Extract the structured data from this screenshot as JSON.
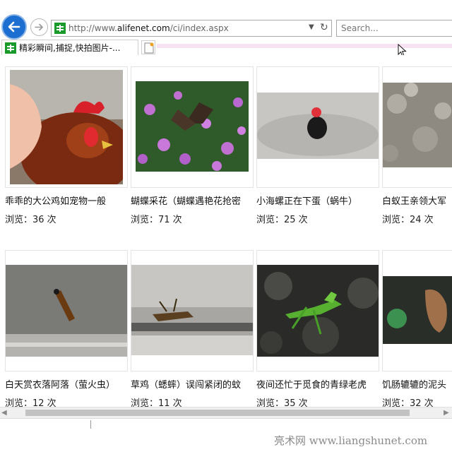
{
  "browser": {
    "address": {
      "url_prefix": "http://www.",
      "url_domain": "alifenet.com",
      "url_path": "/ci/index.aspx"
    },
    "search": {
      "placeholder": "Search..."
    },
    "tab": {
      "title": "精彩瞬间,捕捉,快拍图片-..."
    }
  },
  "gallery": {
    "items": [
      {
        "caption": "乖乖的大公鸡如宠物一般",
        "views": "浏览：36 次"
      },
      {
        "caption": "蝴蝶采花（蝴蝶遇艳花抢密",
        "views": "浏览：71 次"
      },
      {
        "caption": "小海螺正在下蛋（蜗牛）",
        "views": "浏览：25 次"
      },
      {
        "caption": "白蚁王亲领大军",
        "views": "浏览：24 次"
      },
      {
        "caption": "白天赏衣落阿落（萤火虫）",
        "views": "浏览：12 次"
      },
      {
        "caption": "草鸡（蟋蟀）误闯紧闭的蚊",
        "views": "浏览：11 次"
      },
      {
        "caption": "夜间还忙于觅食的青绿老虎",
        "views": "浏览：35 次"
      },
      {
        "caption": "饥肠辘辘的泥头",
        "views": "浏览：32 次"
      }
    ]
  },
  "watermark": {
    "text": "亮术网 www.liangshunet.com"
  },
  "colors": {
    "back_button": "#1c6fd1",
    "favicon": "#1a9a2a",
    "tab_strip": "#f6e2f2"
  }
}
